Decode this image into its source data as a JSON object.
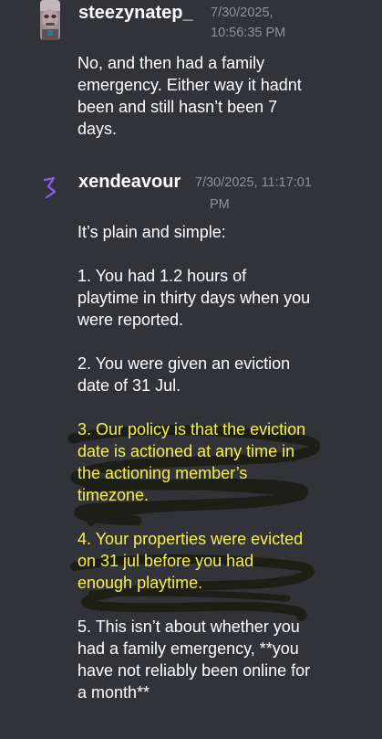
{
  "messages": [
    {
      "username": "steezynatep_",
      "timestamp_line1": "7/30/2025,",
      "timestamp_line2": "10:56:35 PM",
      "lines": [
        "No, and then had a family",
        "emergency. Either way it hadnt",
        "been and still hasn’t been 7",
        "days."
      ]
    },
    {
      "username": "xendeavour",
      "timestamp_line1": "7/30/2025, 11:17:01",
      "timestamp_line2": "PM",
      "paragraphs": [
        {
          "lines": [
            "It’s plain and simple:"
          ]
        },
        {
          "lines": [
            "1. You had 1.2 hours of",
            "playtime in thirty days when you",
            "were reported."
          ]
        },
        {
          "lines": [
            "2. You were given an eviction",
            "date of 31 Jul."
          ]
        },
        {
          "lines": [
            "3. Our policy is that the eviction",
            "date is actioned at any time in",
            "the actioning member’s",
            "timezone."
          ]
        },
        {
          "lines": [
            "4. Your properties were evicted",
            "on 31 jul before you had",
            "enough playtime."
          ]
        },
        {
          "lines": [
            "5. This isn’t about whether you",
            "had a family emergency, **you",
            "have not reliably been online for",
            "a month**"
          ]
        }
      ]
    }
  ],
  "colors": {
    "background": "#323338",
    "text": "#ffffff",
    "timestamp": "#8f9196",
    "highlight_text": "#f6f04a",
    "scribble": "#1a1b10",
    "avatar2_icon": "#8b5cf6"
  }
}
